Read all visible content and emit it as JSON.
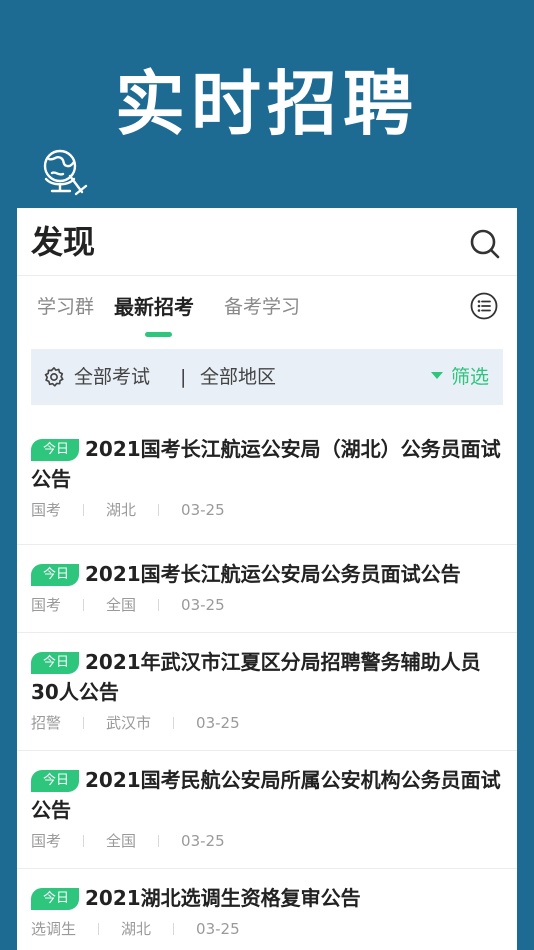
{
  "banner": {
    "title": "实时招聘"
  },
  "header": {
    "title": "发现"
  },
  "tabs": [
    {
      "label": "学习群",
      "active": false
    },
    {
      "label": "最新招考",
      "active": true
    },
    {
      "label": "备考学习",
      "active": false
    }
  ],
  "filter": {
    "exam": "全部考试",
    "divider": "|",
    "region": "全部地区",
    "button": "筛选"
  },
  "items": [
    {
      "badge": "今日",
      "title": "2021国考长江航运公安局（湖北）公务员面试公告",
      "category": "国考",
      "region": "湖北",
      "date": "03-25"
    },
    {
      "badge": "今日",
      "title": "2021国考长江航运公安局公务员面试公告",
      "category": "国考",
      "region": "全国",
      "date": "03-25"
    },
    {
      "badge": "今日",
      "title": "2021年武汉市江夏区分局招聘警务辅助人员30人公告",
      "category": "招警",
      "region": "武汉市",
      "date": "03-25"
    },
    {
      "badge": "今日",
      "title": "2021国考民航公安局所属公安机构公务员面试公告",
      "category": "国考",
      "region": "全国",
      "date": "03-25"
    },
    {
      "badge": "今日",
      "title": "2021湖北选调生资格复审公告",
      "category": "选调生",
      "region": "湖北",
      "date": "03-25"
    }
  ],
  "colors": {
    "background": "#1d6a92",
    "accent": "#2ec57d",
    "filter_bar": "#e8eff6"
  },
  "icons": [
    "globe-search-icon",
    "search-icon",
    "list-icon",
    "gear-icon",
    "triangle-down-icon"
  ]
}
